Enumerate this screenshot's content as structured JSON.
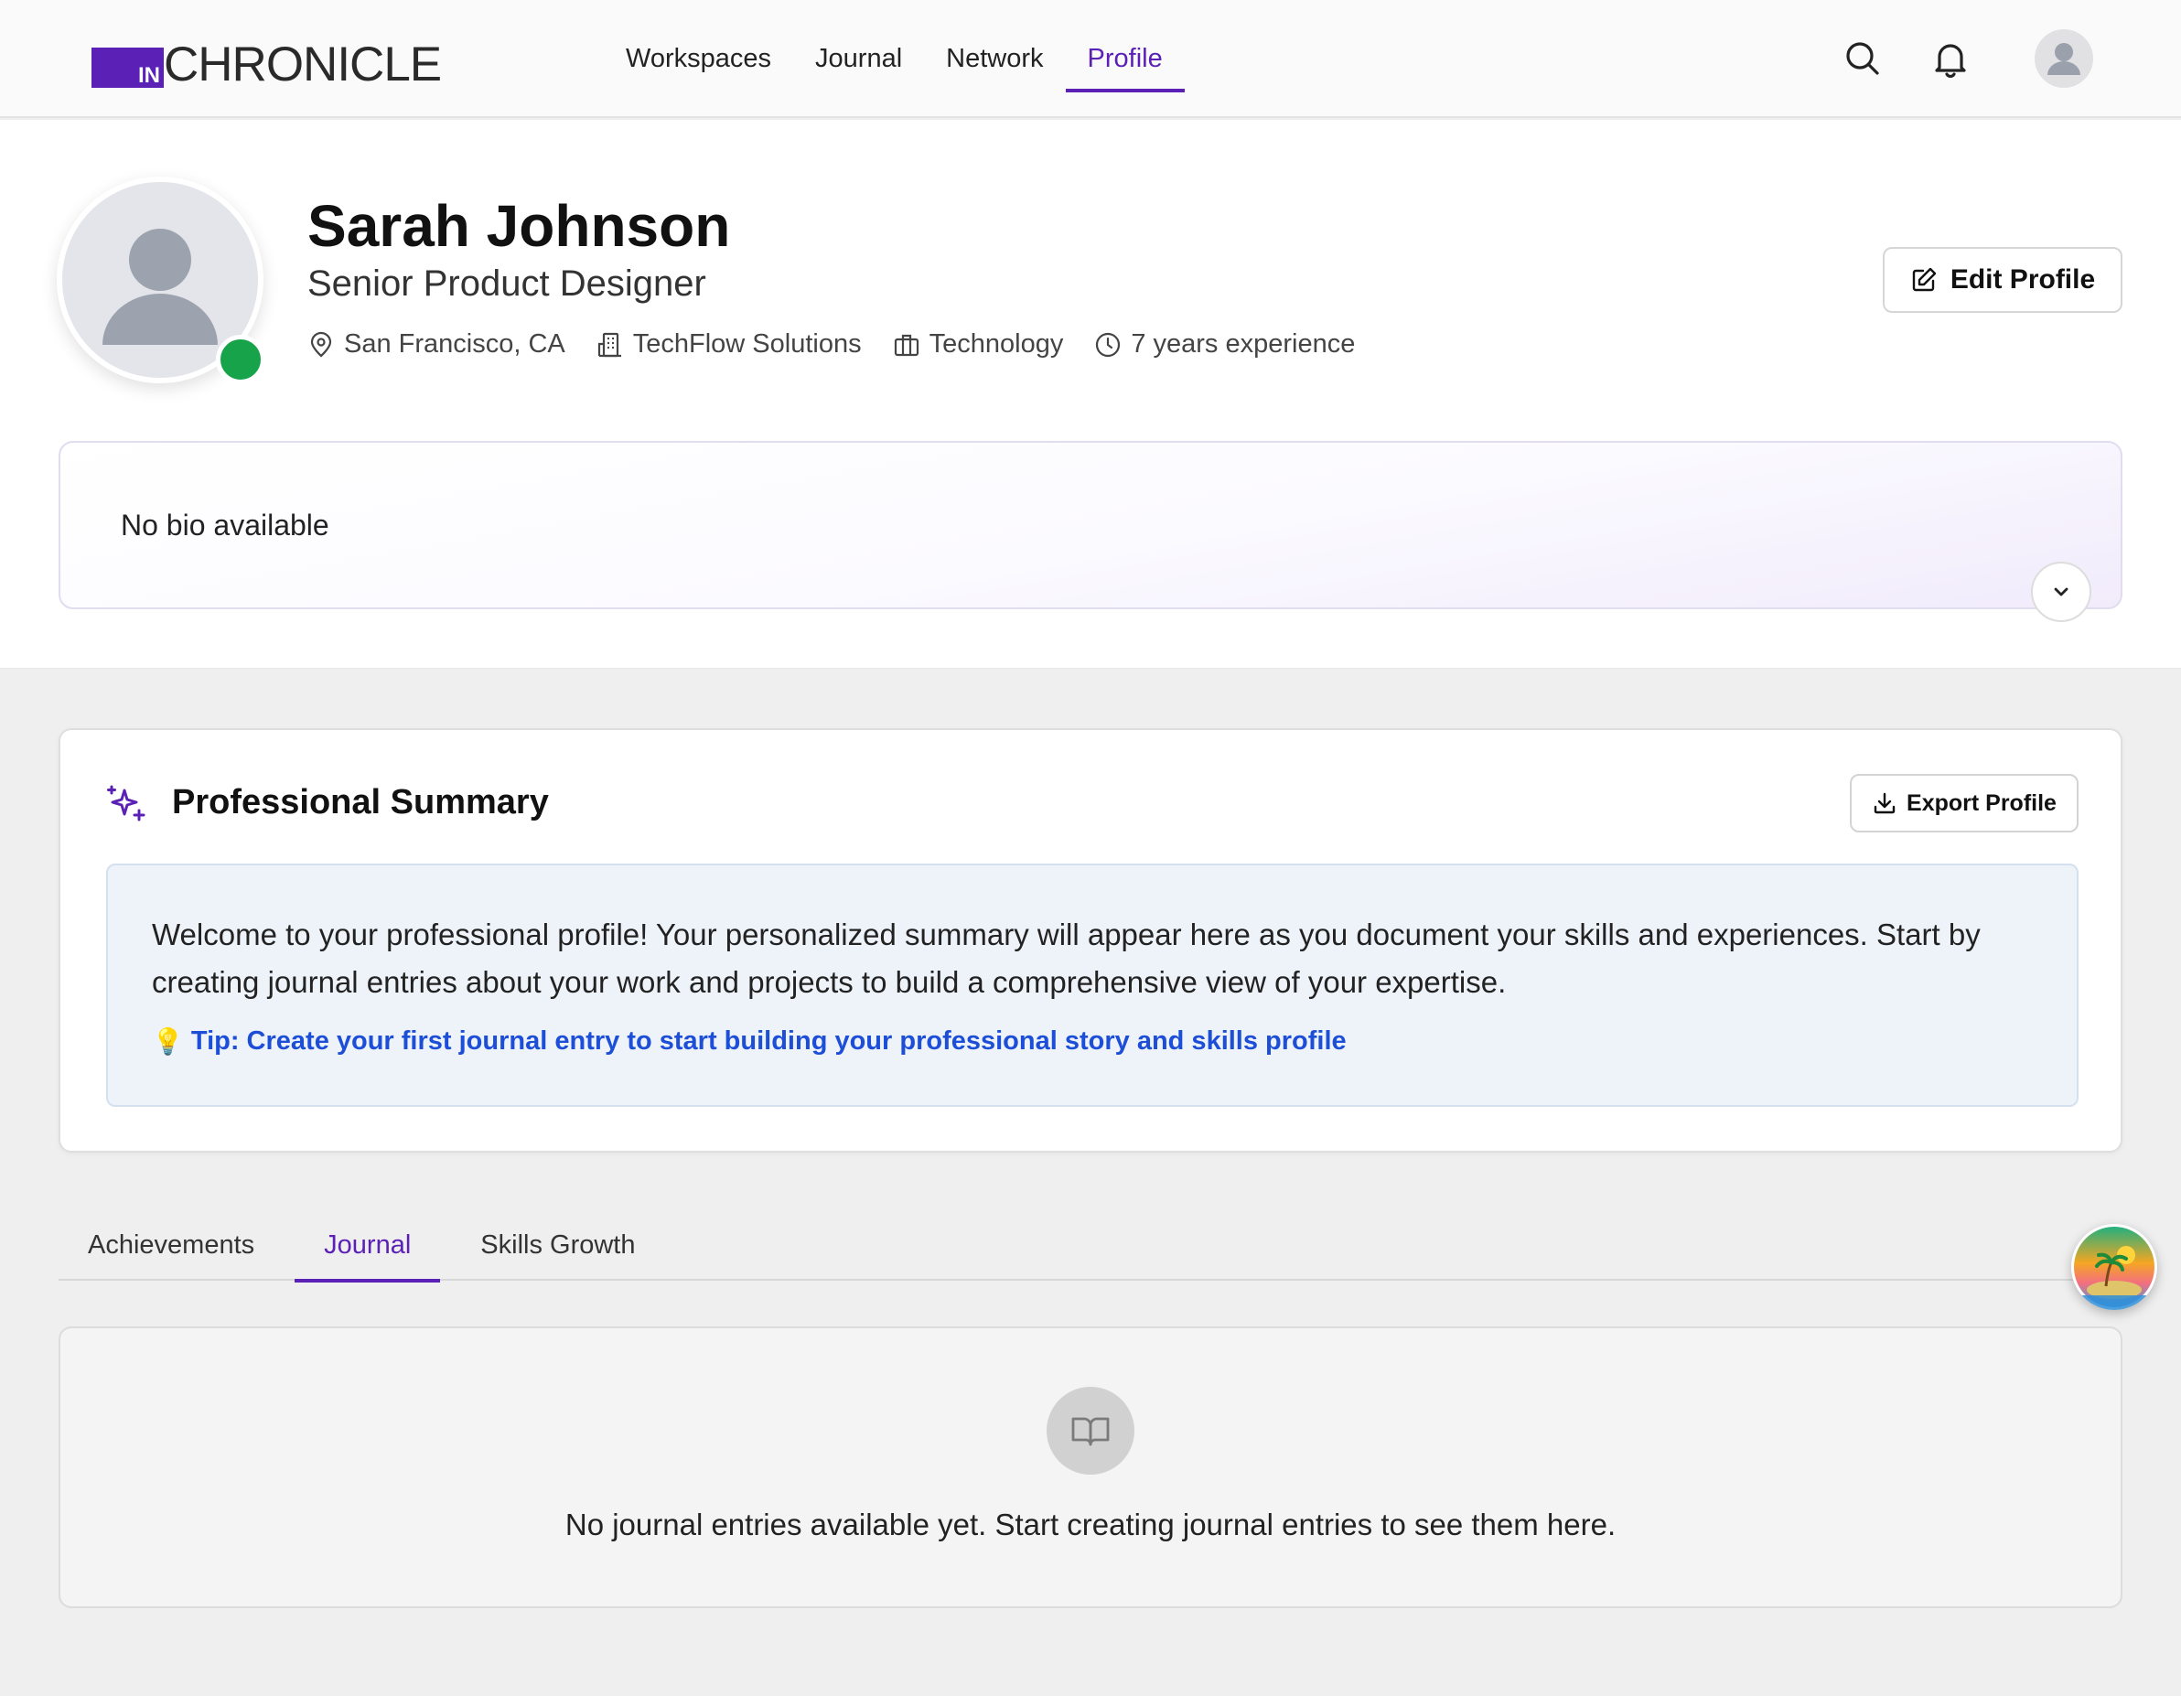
{
  "header": {
    "logo_in": "IN",
    "logo_text": "CHRONICLE",
    "nav": [
      {
        "label": "Workspaces",
        "active": false
      },
      {
        "label": "Journal",
        "active": false
      },
      {
        "label": "Network",
        "active": false
      },
      {
        "label": "Profile",
        "active": true
      }
    ],
    "icons": [
      "search-icon",
      "bell-icon",
      "user-avatar"
    ],
    "accent_color": "#5b21b6"
  },
  "profile": {
    "name": "Sarah Johnson",
    "title": "Senior Product Designer",
    "status_color": "#16a34a",
    "meta": {
      "location": "San Francisco, CA",
      "company": "TechFlow Solutions",
      "industry": "Technology",
      "experience": "7 years experience"
    },
    "edit_label": "Edit Profile",
    "bio": "No bio available"
  },
  "summary": {
    "title": "Professional Summary",
    "export_label": "Export Profile",
    "text": "Welcome to your professional profile! Your personalized summary will appear here as you document your skills and experiences. Start by creating journal entries about your work and projects to build a comprehensive view of your expertise.",
    "tip_icon": "💡",
    "tip": "Tip: Create your first journal entry to start building your professional story and skills profile"
  },
  "tabs": [
    {
      "label": "Achievements",
      "active": false
    },
    {
      "label": "Journal",
      "active": true
    },
    {
      "label": "Skills Growth",
      "active": false
    }
  ],
  "journal": {
    "empty_text": "No journal entries available yet. Start creating journal entries to see them here."
  }
}
